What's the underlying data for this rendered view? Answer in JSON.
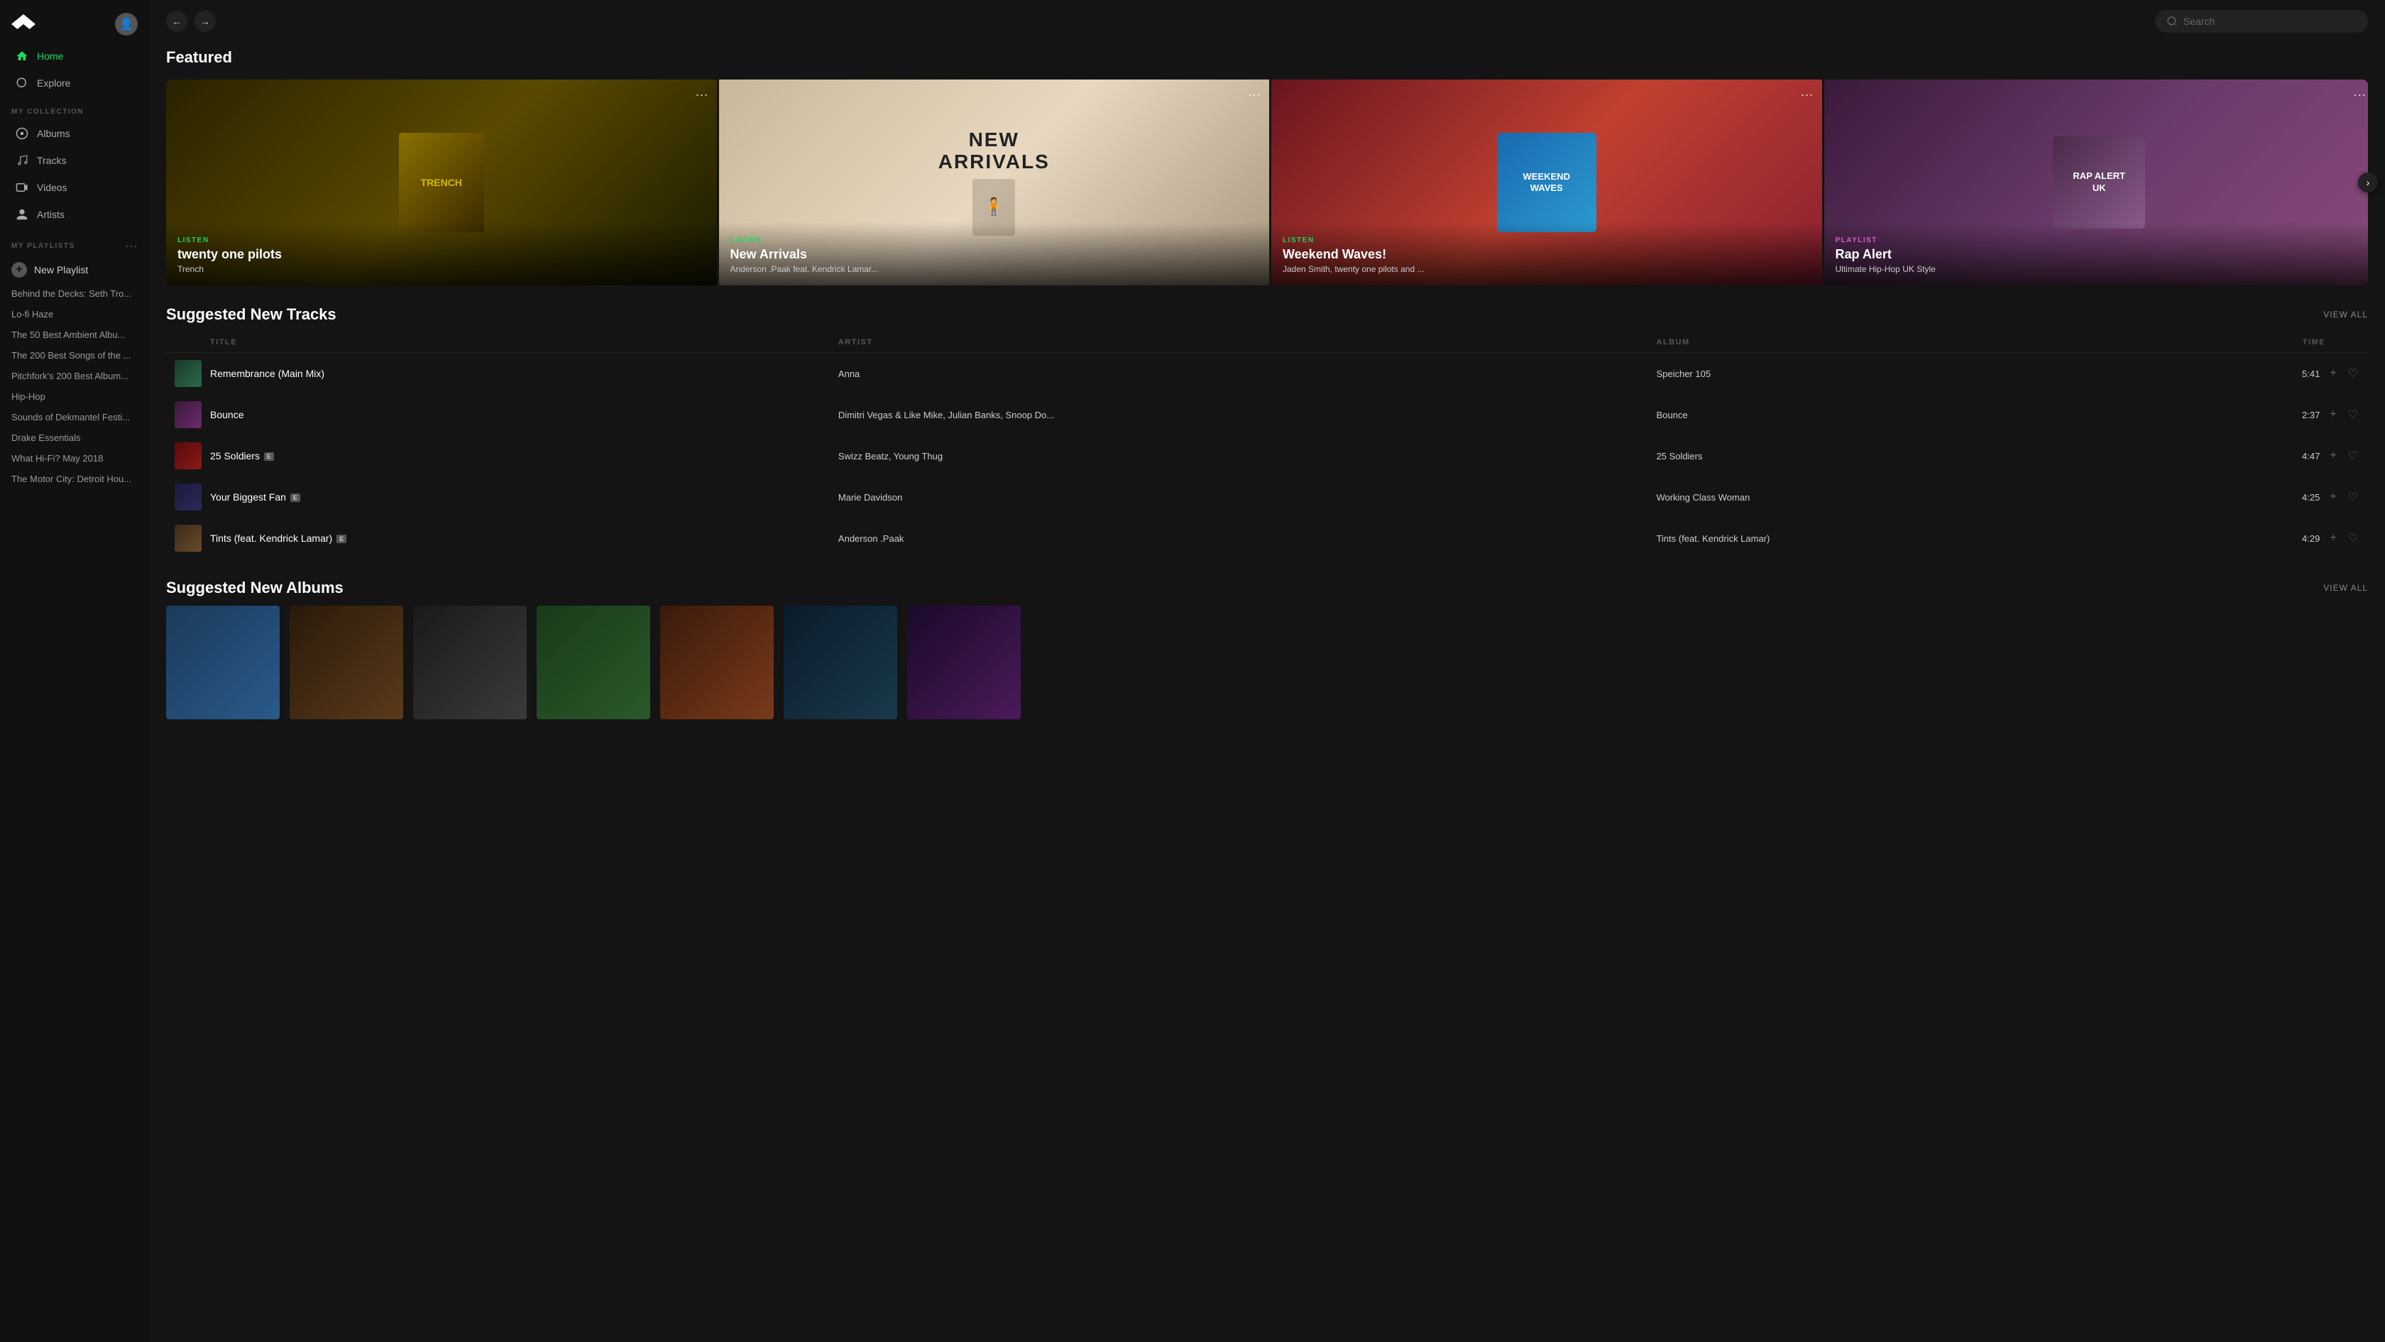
{
  "app": {
    "title": "Tidal"
  },
  "sidebar": {
    "my_collection_label": "MY COLLECTION",
    "my_playlists_label": "MY PLAYLISTS",
    "nav_items": [
      {
        "id": "home",
        "label": "Home",
        "icon": "home-icon",
        "active": true
      },
      {
        "id": "explore",
        "label": "Explore",
        "icon": "explore-icon",
        "active": false
      }
    ],
    "collection_items": [
      {
        "id": "albums",
        "label": "Albums",
        "icon": "album-icon"
      },
      {
        "id": "tracks",
        "label": "Tracks",
        "icon": "track-icon"
      },
      {
        "id": "videos",
        "label": "Videos",
        "icon": "video-icon"
      },
      {
        "id": "artists",
        "label": "Artists",
        "icon": "artist-icon"
      }
    ],
    "new_playlist_label": "New Playlist",
    "playlists": [
      "Behind the Decks: Seth Tro...",
      "Lo-fi Haze",
      "The 50 Best Ambient Albu...",
      "The 200 Best Songs of the ...",
      "Pitchfork's 200 Best Album...",
      "Hip-Hop",
      "Sounds of Dekmantel Festi...",
      "Drake Essentials",
      "What Hi-Fi? May 2018",
      "The Motor City: Detroit Hou..."
    ]
  },
  "topbar": {
    "search_placeholder": "Search"
  },
  "featured": {
    "section_title": "Featured",
    "cards": [
      {
        "id": "trench",
        "type_label": "LISTEN",
        "type_color": "#1ed760",
        "title": "twenty one pilots",
        "subtitle": "Trench",
        "bg_class": "card-trench"
      },
      {
        "id": "arrivals",
        "type_label": "LISTEN",
        "type_color": "#1ed760",
        "title": "New Arrivals",
        "subtitle": "Anderson .Paak feat. Kendrick Lamar...",
        "bg_class": "card-arrivals"
      },
      {
        "id": "waves",
        "type_label": "LISTEN",
        "type_color": "#1ed760",
        "title": "Weekend Waves!",
        "subtitle": "Jaden Smith, twenty one pilots and ...",
        "bg_class": "card-waves"
      },
      {
        "id": "rap",
        "type_label": "PLAYLIST",
        "type_color": "#d760c0",
        "title": "Rap Alert",
        "subtitle": "Ultimate Hip-Hop UK Style",
        "bg_class": "card-rap"
      }
    ]
  },
  "suggested_tracks": {
    "section_title": "Suggested New Tracks",
    "view_all_label": "View all",
    "columns": {
      "title": "TITLE",
      "artist": "ARTIST",
      "album": "ALBUM",
      "time": "TIME"
    },
    "tracks": [
      {
        "id": 1,
        "title": "Remembrance (Main Mix)",
        "explicit": false,
        "artist": "Anna",
        "album": "Speicher 105",
        "time": "5:41",
        "thumb_class": "tthumb-1"
      },
      {
        "id": 2,
        "title": "Bounce",
        "explicit": false,
        "artist": "Dimitri Vegas & Like Mike, Julian Banks, Snoop Do...",
        "album": "Bounce",
        "time": "2:37",
        "thumb_class": "tthumb-2"
      },
      {
        "id": 3,
        "title": "25 Soldiers",
        "explicit": true,
        "artist": "Swizz Beatz, Young Thug",
        "album": "25 Soldiers",
        "time": "4:47",
        "thumb_class": "tthumb-3"
      },
      {
        "id": 4,
        "title": "Your Biggest Fan",
        "explicit": true,
        "artist": "Marie Davidson",
        "album": "Working Class Woman",
        "time": "4:25",
        "thumb_class": "tthumb-4"
      },
      {
        "id": 5,
        "title": "Tints (feat. Kendrick Lamar)",
        "explicit": true,
        "artist": "Anderson .Paak",
        "album": "Tints (feat. Kendrick Lamar)",
        "time": "4:29",
        "thumb_class": "tthumb-5"
      }
    ]
  },
  "suggested_albums": {
    "section_title": "Suggested New Albums",
    "view_all_label": "View all",
    "albums": [
      {
        "id": 1,
        "thumb_class": "thumb-1"
      },
      {
        "id": 2,
        "thumb_class": "thumb-2"
      },
      {
        "id": 3,
        "thumb_class": "thumb-3"
      },
      {
        "id": 4,
        "thumb_class": "thumb-4"
      },
      {
        "id": 5,
        "thumb_class": "thumb-5"
      },
      {
        "id": 6,
        "thumb_class": "thumb-6"
      },
      {
        "id": 7,
        "thumb_class": "thumb-7"
      }
    ]
  }
}
